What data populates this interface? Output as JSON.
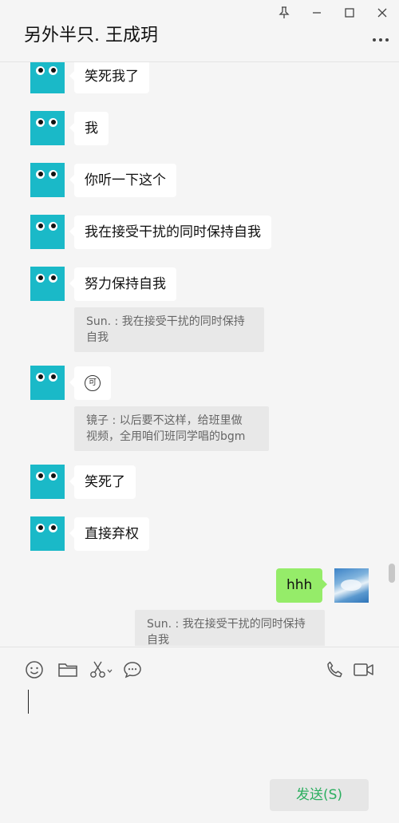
{
  "window": {
    "title": "另外半只. 王成玥"
  },
  "messages": {
    "m1": "笑死我了",
    "m2": "我",
    "m3": "你听一下这个",
    "m4": "我在接受干扰的同时保持自我",
    "m5": "努力保持自我",
    "q1_line1": "Sun. : 我在接受干扰的同时保持",
    "q1_line2": "自我",
    "m6_badge": "可",
    "q2_line1": "镜子 : 以后要不这样，给班里做",
    "q2_line2": "视频，全用咱们班同学唱的bgm",
    "m7": "笑死了",
    "m8": "直接弃权",
    "m9_me": "hhh",
    "q3_line1": "Sun. : 我在接受干扰的同时保持",
    "q3_line2": "自我"
  },
  "composer": {
    "send_label": "发送(S)",
    "input_value": ""
  },
  "icons": [
    "pin-icon",
    "minimize-icon",
    "maximize-icon",
    "close-icon",
    "more-icon",
    "emoji-icon",
    "folder-icon",
    "scissors-icon",
    "chat-history-icon",
    "phone-icon",
    "video-icon"
  ],
  "colors": {
    "avatar": "#1ab9c8",
    "my_bubble": "#95ec69",
    "send_text": "#2bae5f"
  }
}
